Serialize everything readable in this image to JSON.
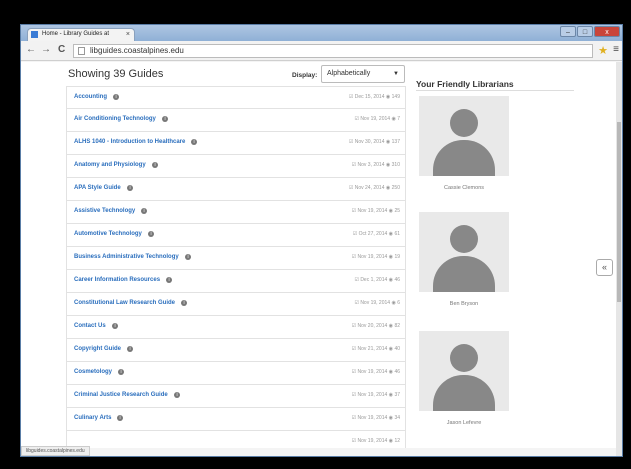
{
  "browser": {
    "tab_title": "Home - Library Guides at",
    "tab_close": "×",
    "url": "libguides.coastalpines.edu",
    "status_url": "libguides.coastalpines.edu",
    "back": "←",
    "forward": "→",
    "reload": "C",
    "bookmark_icon": "star-icon",
    "menu": "≡",
    "min": "–",
    "max": "□",
    "close": "x"
  },
  "guides": {
    "showing": "Showing 39 Guides",
    "display_label": "Display:",
    "display_value": "Alphabetically",
    "display_caret": "▼",
    "items": [
      {
        "name": "Accounting",
        "date": "Dec 15, 2014",
        "views": "149"
      },
      {
        "name": "Air Conditioning Technology",
        "date": "Nov 19, 2014",
        "views": "7"
      },
      {
        "name": "ALHS 1040 - Introduction to Healthcare",
        "date": "Nov 30, 2014",
        "views": "137"
      },
      {
        "name": "Anatomy and Physiology",
        "date": "Nov 3, 2014",
        "views": "310"
      },
      {
        "name": "APA Style Guide",
        "date": "Nov 24, 2014",
        "views": "250"
      },
      {
        "name": "Assistive Technology",
        "date": "Nov 19, 2014",
        "views": "25"
      },
      {
        "name": "Automotive Technology",
        "date": "Oct 27, 2014",
        "views": "61"
      },
      {
        "name": "Business Administrative Technology",
        "date": "Nov 19, 2014",
        "views": "19"
      },
      {
        "name": "Career Information Resources",
        "date": "Dec 1, 2014",
        "views": "46"
      },
      {
        "name": "Constitutional Law Research Guide",
        "date": "Nov 19, 2014",
        "views": "6"
      },
      {
        "name": "Contact Us",
        "date": "Nov 20, 2014",
        "views": "82"
      },
      {
        "name": "Copyright Guide",
        "date": "Nov 21, 2014",
        "views": "40"
      },
      {
        "name": "Cosmetology",
        "date": "Nov 19, 2014",
        "views": "46"
      },
      {
        "name": "Criminal Justice Research Guide",
        "date": "Nov 19, 2014",
        "views": "37"
      },
      {
        "name": "Culinary Arts",
        "date": "Nov 19, 2014",
        "views": "34"
      },
      {
        "name": "",
        "date": "Nov 19, 2014",
        "views": "12"
      }
    ]
  },
  "sidebar": {
    "title": "Your Friendly Librarians",
    "librarians": [
      "Cassie Clemons",
      "Ben Bryson",
      "Jason Lefevre"
    ]
  },
  "back_to_top": "«"
}
